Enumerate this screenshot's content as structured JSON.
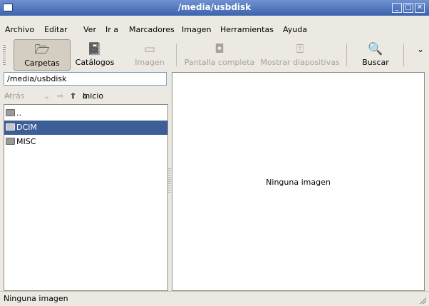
{
  "window": {
    "title": "/media/usbdisk"
  },
  "menubar": {
    "items": [
      "Archivo",
      "Editar",
      "Ver",
      "Ir a",
      "Marcadores",
      "Imagen",
      "Herramientas",
      "Ayuda"
    ]
  },
  "toolbar": {
    "folders_label": "Carpetas",
    "catalogs_label": "Catálogos",
    "image_label": "Imagen",
    "fullscreen_label": "Pantalla completa",
    "slideshow_label": "Mostrar diapositivas",
    "search_label": "Buscar"
  },
  "location": {
    "path": "/media/usbdisk"
  },
  "nav": {
    "back_label": "Atrás",
    "home_label": "Inicio"
  },
  "files": [
    {
      "name": "..",
      "selected": false
    },
    {
      "name": "DCIM",
      "selected": true
    },
    {
      "name": "MISC",
      "selected": false
    }
  ],
  "viewer": {
    "message": "Ninguna imagen"
  },
  "status": {
    "text": "Ninguna imagen"
  },
  "colors": {
    "titlebar": "#4a6fb8",
    "selection": "#3d5f98",
    "background": "#ece9e2"
  }
}
